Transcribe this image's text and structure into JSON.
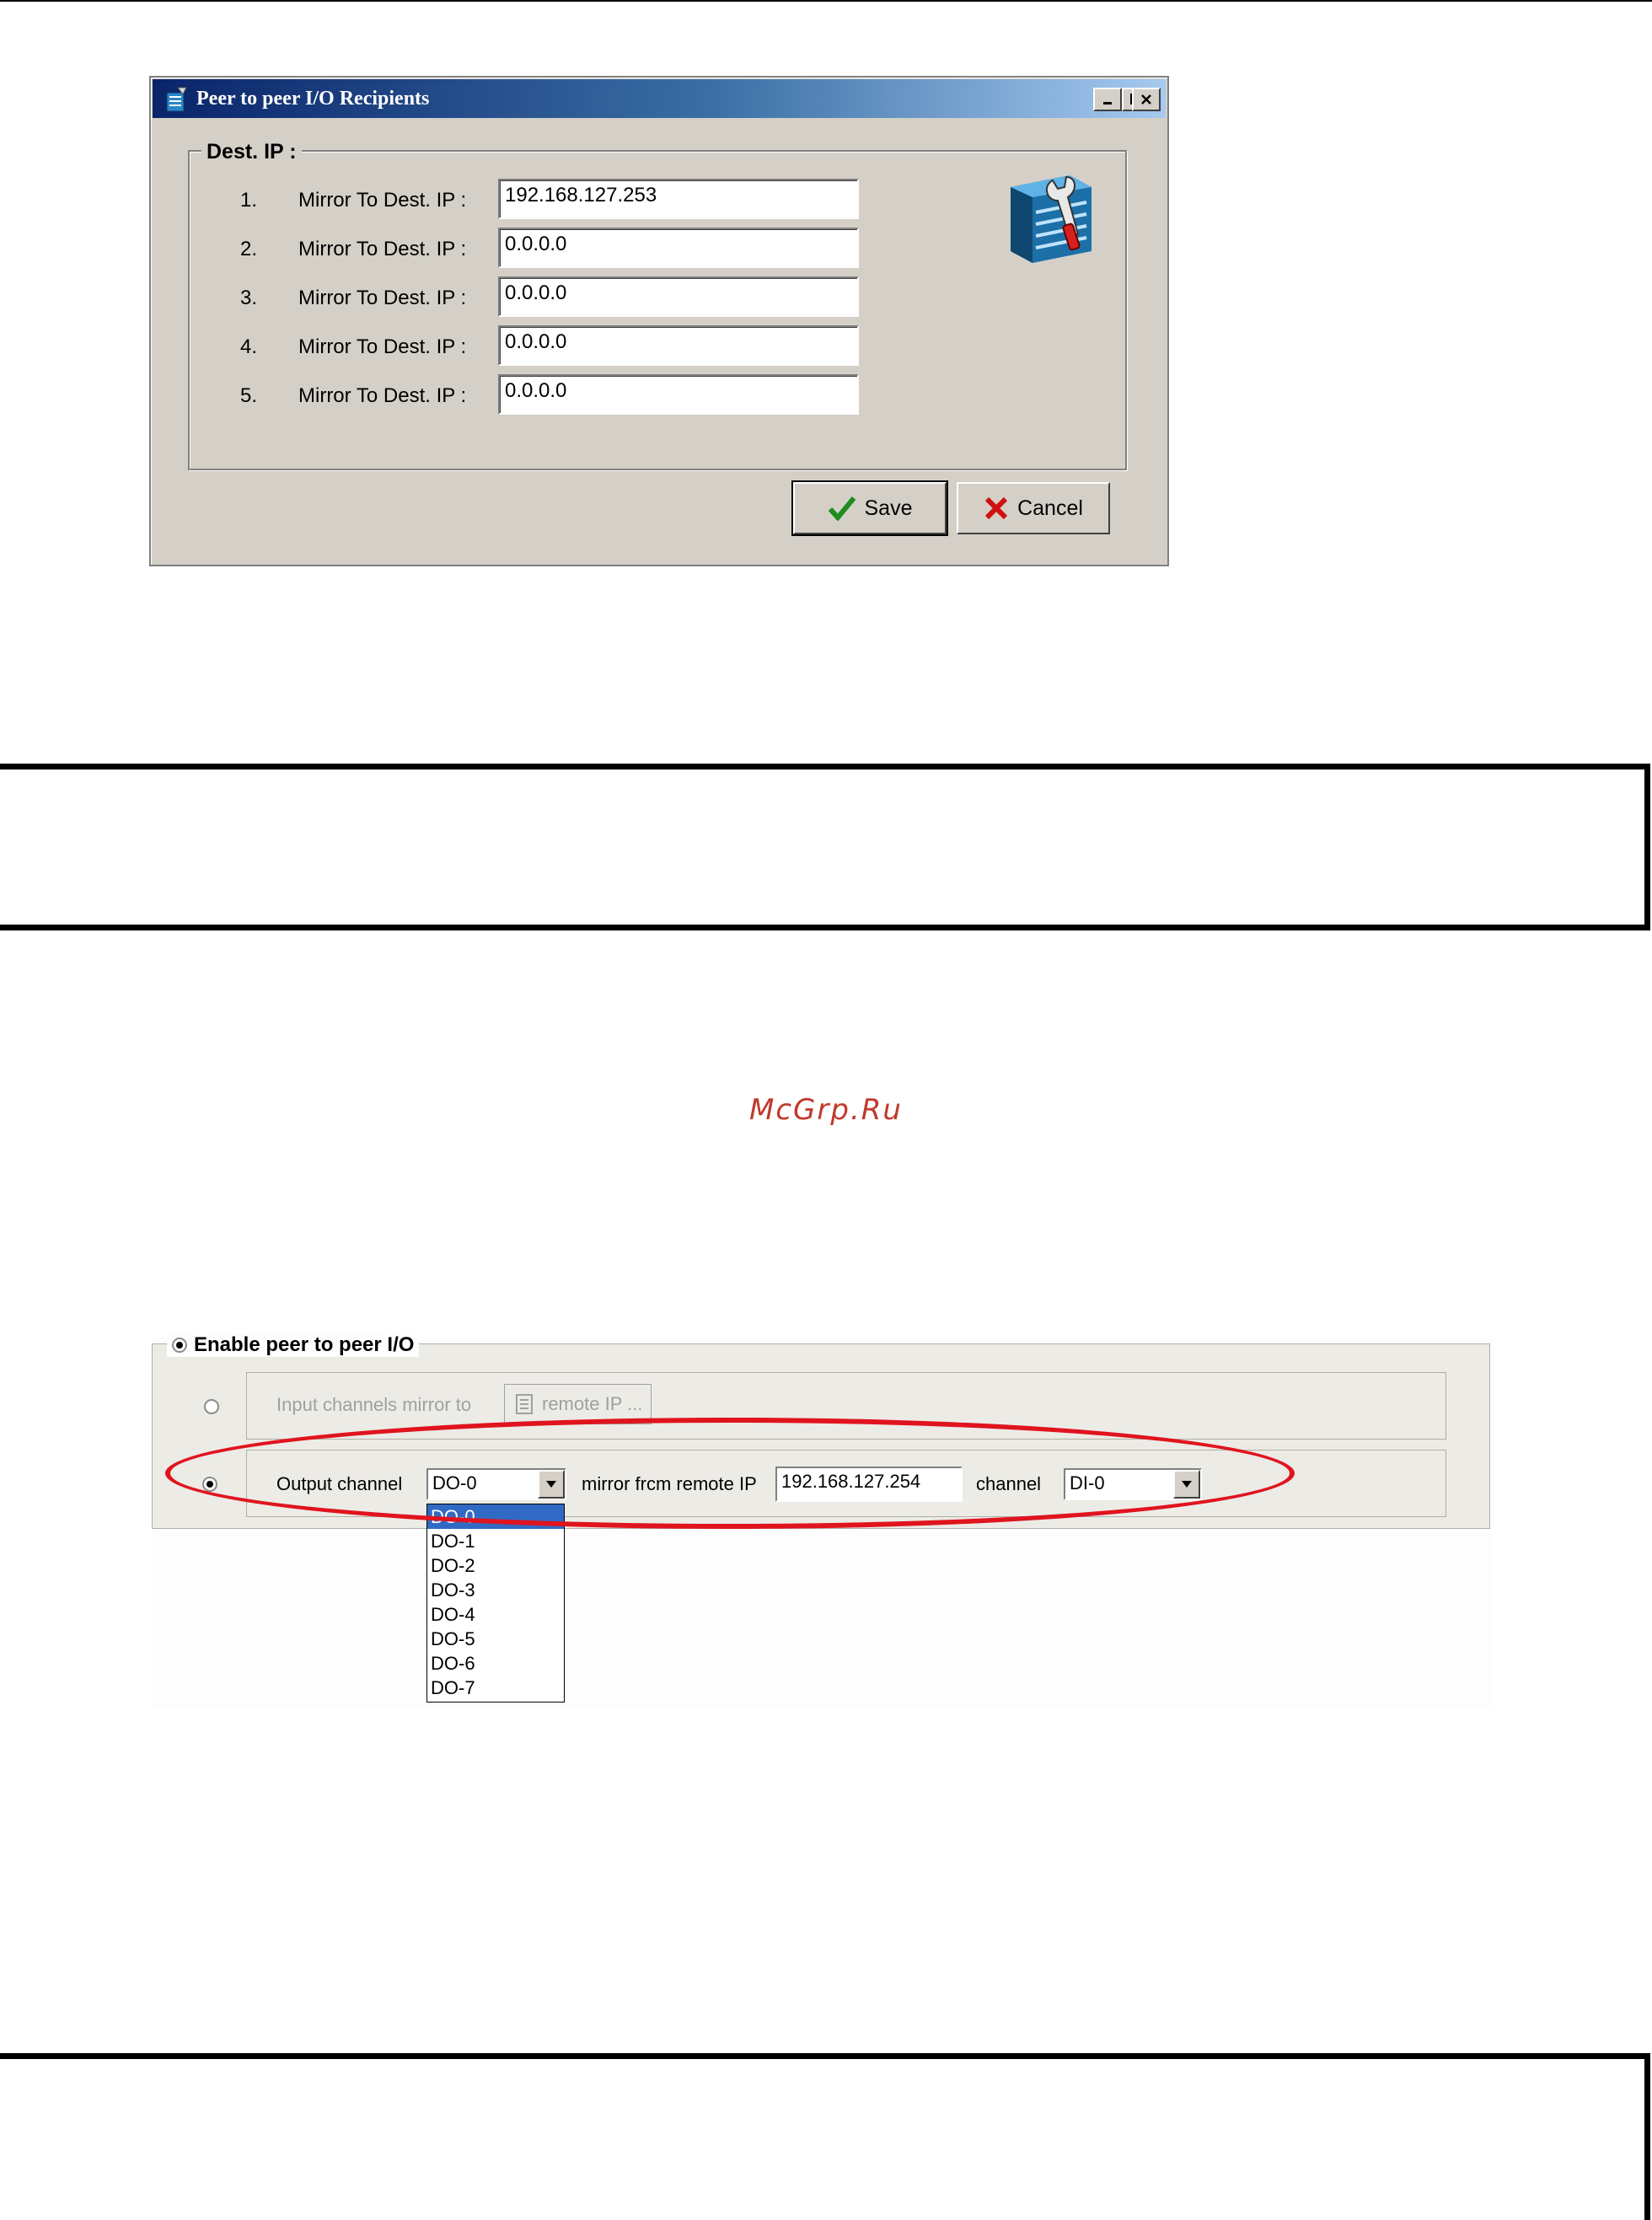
{
  "dialog": {
    "title": "Peer to peer I/O Recipients",
    "group_label": "Dest. IP :",
    "rows": [
      {
        "num": "1.",
        "label": "Mirror To Dest. IP :",
        "value": "192.168.127.253"
      },
      {
        "num": "2.",
        "label": "Mirror To Dest. IP :",
        "value": "0.0.0.0"
      },
      {
        "num": "3.",
        "label": "Mirror To Dest. IP :",
        "value": "0.0.0.0"
      },
      {
        "num": "4.",
        "label": "Mirror To Dest. IP :",
        "value": "0.0.0.0"
      },
      {
        "num": "5.",
        "label": "Mirror To Dest. IP :",
        "value": "0.0.0.0"
      }
    ],
    "save_label": "Save",
    "cancel_label": "Cancel"
  },
  "watermark": "McGrp.Ru",
  "peer_panel": {
    "enable_label": "Enable peer to peer I/O",
    "input_label": "Input channels mirror to",
    "remote_ip_button": "remote IP ...",
    "output_label": "Output channel",
    "output_value": "DO-0",
    "mirror_label": "mirror frcm remote IP",
    "mirror_ip": "192.168.127.254",
    "channel_label": "channel",
    "channel_value": "DI-0",
    "dropdown_options": [
      "DO-0",
      "DO-1",
      "DO-2",
      "DO-3",
      "DO-4",
      "DO-5",
      "DO-6",
      "DO-7"
    ]
  },
  "colors": {
    "highlight_ellipse": "#e0141e",
    "title_bar": "#0a246a",
    "selection": "#316ac5"
  }
}
